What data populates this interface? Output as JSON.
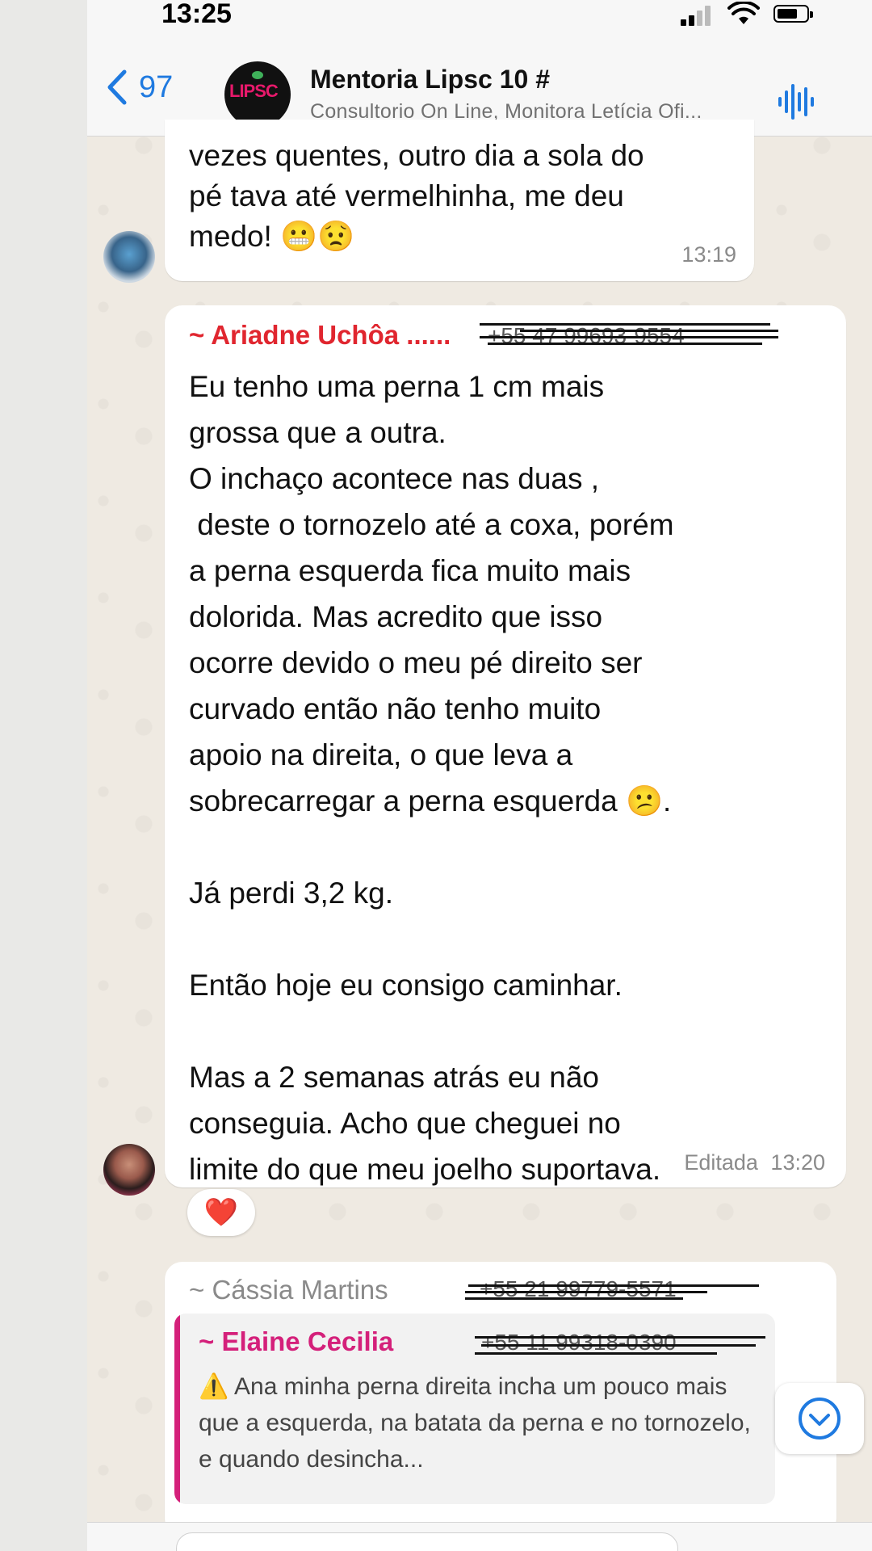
{
  "status_bar": {
    "time": "13:25"
  },
  "header": {
    "back_count": "97",
    "avatar_logo": "LIPSC",
    "title": "Mentoria Lipsc 10 #",
    "subtitle": "Consultorio On Line, Monitora Letícia Ofi..."
  },
  "messages": [
    {
      "text": "vezes quentes, outro dia a sola do\npé tava até vermelhinha, me deu\nmedo! 😬😟",
      "time": "13:19"
    },
    {
      "sender": "~ Ariadne Uchôa ......",
      "sender_color": "#e0262f",
      "phone": "+55 47 99693-9554",
      "text": "Eu tenho uma perna 1 cm mais\ngrossa que a outra.\nO inchaço acontece nas duas ,\n deste o tornozelo até a coxa, porém\na perna esquerda fica muito mais\ndolorida. Mas acredito que isso\nocorre devido o meu pé direito ser\ncurvado então não tenho muito\napoio na direita, o que leva a\nsobrecarregar a perna esquerda 😕.\n\nJá perdi 3,2 kg.\n\nEntão hoje eu consigo caminhar.\n\nMas a 2 semanas atrás eu não\nconseguia. Acho que cheguei no\nlimite do que meu joelho suportava.",
      "edited_label": "Editada",
      "time": "13:20",
      "reaction": "❤️"
    },
    {
      "sender": "~ Cássia Martins",
      "sender_color": "#8a8a8a",
      "phone": "+55 21 99779-5571",
      "quote": {
        "sender": "~ Elaine Cecilia",
        "sender_color": "#d4207a",
        "phone": "+55 11 99318-0390",
        "text": "⚠️ Ana minha perna direita incha um pouco mais que a esquerda, na batata da perna e no tornozelo, e quando desincha..."
      }
    }
  ],
  "icons": {
    "back": "chevron-left-icon",
    "voice": "audio-wave-icon",
    "scroll": "chevron-down-circle-icon"
  },
  "colors": {
    "accent": "#1f7ae0",
    "chat_bg": "#efeae2",
    "bubble": "#ffffff"
  }
}
